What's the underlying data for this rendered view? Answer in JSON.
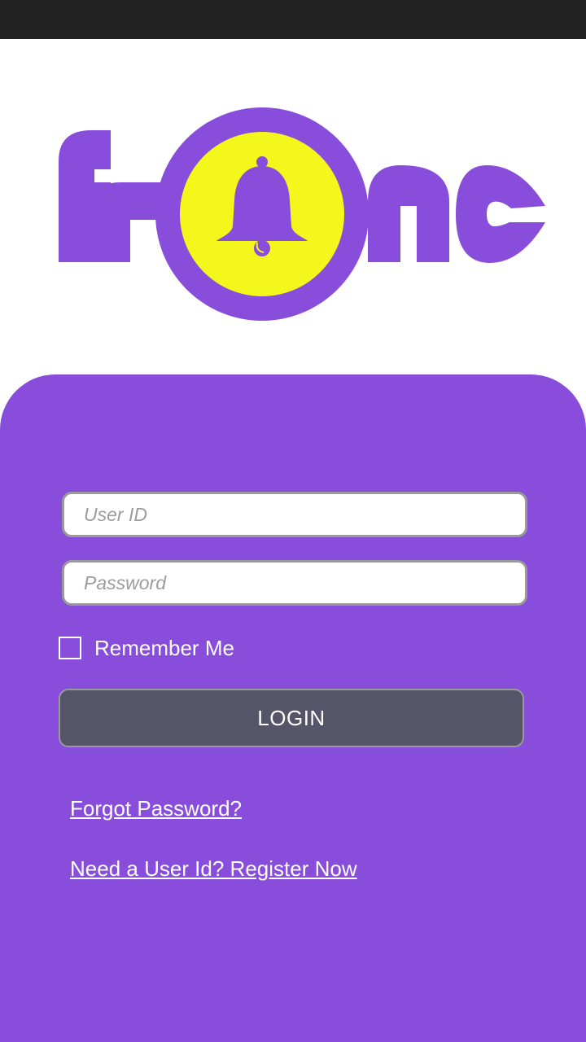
{
  "colors": {
    "brand_purple": "#884ddb",
    "bell_yellow": "#f3f71c",
    "button_gray": "#555569",
    "status_bar": "#222222"
  },
  "logo": {
    "brand_text": "franc",
    "icon": "bell-icon"
  },
  "login_form": {
    "user_id_placeholder": "User ID",
    "password_placeholder": "Password",
    "remember_me_label": "Remember Me",
    "remember_me_checked": false,
    "login_label": "LOGIN",
    "forgot_password_label": "Forgot Password?",
    "register_label": "Need a User Id? Register Now"
  }
}
